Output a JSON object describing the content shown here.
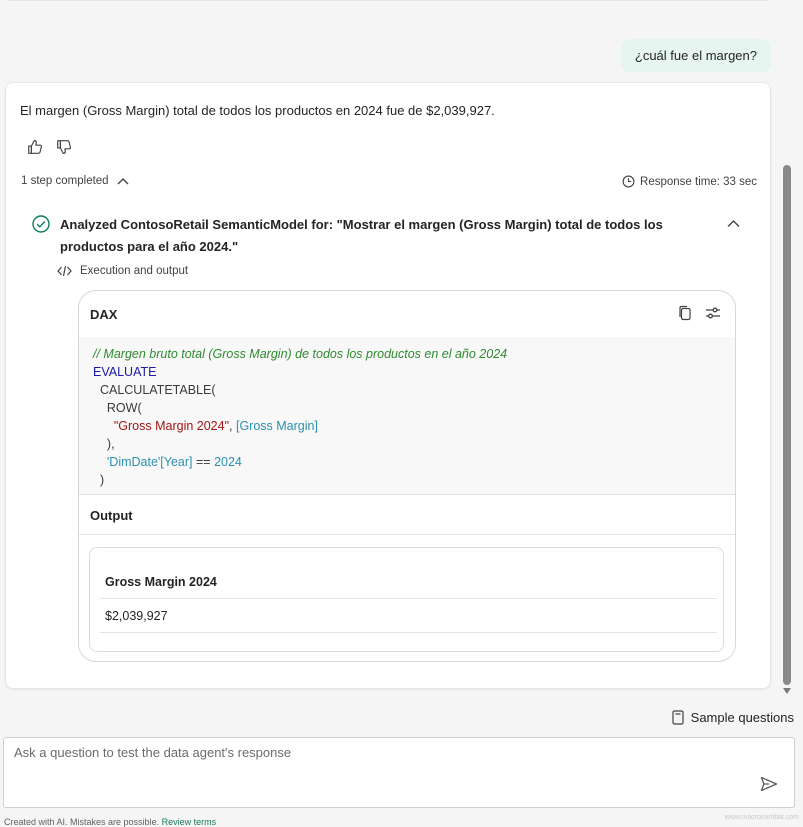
{
  "user_message": "¿cuál fue el margen?",
  "answer": {
    "text": "El margen (Gross Margin) total de todos los productos en 2024 fue de $2,039,927.",
    "steps_label": "1 step completed",
    "response_time": "Response time: 33 sec"
  },
  "step": {
    "title": "Analyzed ContosoRetail SemanticModel for: \"Mostrar el margen (Gross Margin) total de todos los productos para el año 2024.\"",
    "execution_label": "Execution and output"
  },
  "code": {
    "language": "DAX",
    "comment": "// Margen bruto total (Gross Margin) de todos los productos en el año 2024",
    "keyword_evaluate": "EVALUATE",
    "calculatetable": "CALCULATETABLE(",
    "row_open": "ROW(",
    "string_col": "\"Gross Margin 2024\"",
    "comma": ", ",
    "measure_ref": "[Gross Margin]",
    "row_close": "),",
    "table_ref": "'DimDate'[Year]",
    "operator": " == ",
    "year_value": "2024",
    "close_paren": ")"
  },
  "output": {
    "label": "Output",
    "column_header": "Gross Margin 2024",
    "value": "$2,039,927"
  },
  "sample_questions_label": "Sample questions",
  "input": {
    "placeholder": "Ask a question to test the data agent's response"
  },
  "footer": {
    "disclaimer": "Created with AI. Mistakes are possible. ",
    "review_link": "Review terms",
    "watermark": "www.macrocombat.com"
  },
  "colors": {
    "accent_green": "#0f7b5a",
    "user_bubble": "#e7f5f0",
    "comment": "#2e8b2e",
    "keyword": "#1a1aa6",
    "string": "#a31515",
    "reference": "#2b91af"
  }
}
